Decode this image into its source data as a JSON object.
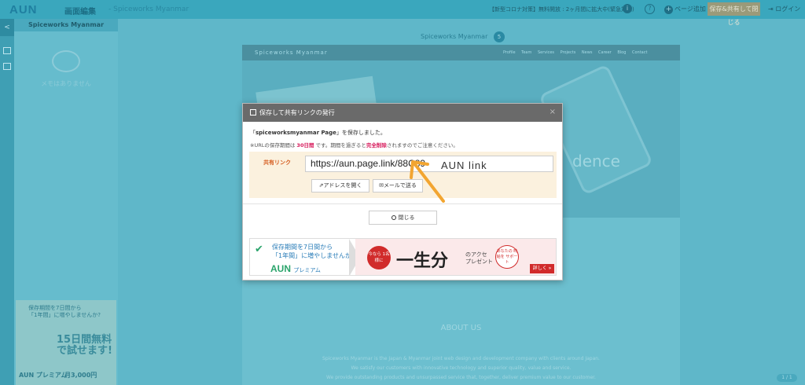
{
  "topbar": {
    "logo": "AUN",
    "title": "画面編集",
    "subtitle": "- Spiceworks Myanmar",
    "notice": "【新型コロナ対策】無料開放 : 2ヶ月間に拡大中(緊急対応)",
    "notice_icon": "i",
    "help_icon": "?",
    "add_page": "ページ追加",
    "save_button": "保存&共有して閉じる",
    "login": "ログイン"
  },
  "rail": {
    "toggle": "<"
  },
  "left_panel": {
    "header": "Spiceworks Myanmar",
    "empty_memo": "メモはありません",
    "ad": {
      "line1": "保存期間を7日間から",
      "line2": "「1年間」に増やしませんか?",
      "headline1": "15日間無料",
      "headline2": "で試せます!",
      "brand": "AUN プレミアム",
      "price": "月3,000円"
    }
  },
  "preview": {
    "title": "Spiceworks Myanmar",
    "badge": "5",
    "site_brand": "Spiceworks Myanmar",
    "menu": "Profile Team Services Projects News Career Blog Contact",
    "hero_text": "dence",
    "about_title": "ABOUT US",
    "body_line1": "Spiceworks Myanmar is the Japan & Myanmar joint web design and development company with clients around Japan.",
    "body_line2": "We satisfy our customers with innovative technology and superior quality, value and service.",
    "body_line3": "We provide outstanding products and unsurpassed service that, together, deliver premium value to our customer.",
    "page_indicator": "1 / 1"
  },
  "modal": {
    "title": "保存して共有リンクの発行",
    "close": "×",
    "message_pre": "「",
    "page_name": "spiceworksmyanmar Page",
    "message_post": "」を保存しました。",
    "period_pre": "※URLの保存期間は",
    "period_days": "30日間",
    "period_mid": "です。期間を過ぎると",
    "period_delete": "完全削除",
    "period_post": "されますのでご注意ください。",
    "link_label": "共有リンク",
    "link_value": "https://aun.page.link/88C89",
    "annotation": "AUN link",
    "open_address": "アドレスを開く",
    "send_mail": "メールで送る",
    "close_button": "閉じる",
    "banner": {
      "line1": "保存期間を7日間から",
      "line2": "「1年間」に増やしませんか?",
      "brand": "AUN",
      "brand_sub": "プレミアム",
      "circle_text": "今なら 1名様に",
      "headline": "一生分",
      "present_sub": "のアクセ",
      "present": "プレゼント",
      "support": "あなたの 時給を サポート",
      "detail": "詳しく »"
    }
  },
  "colors": {
    "accent_red": "#d6195a",
    "link_label": "#d45a1c",
    "annotation_arrow": "#f2a531",
    "premium_green": "#2aa46b"
  }
}
